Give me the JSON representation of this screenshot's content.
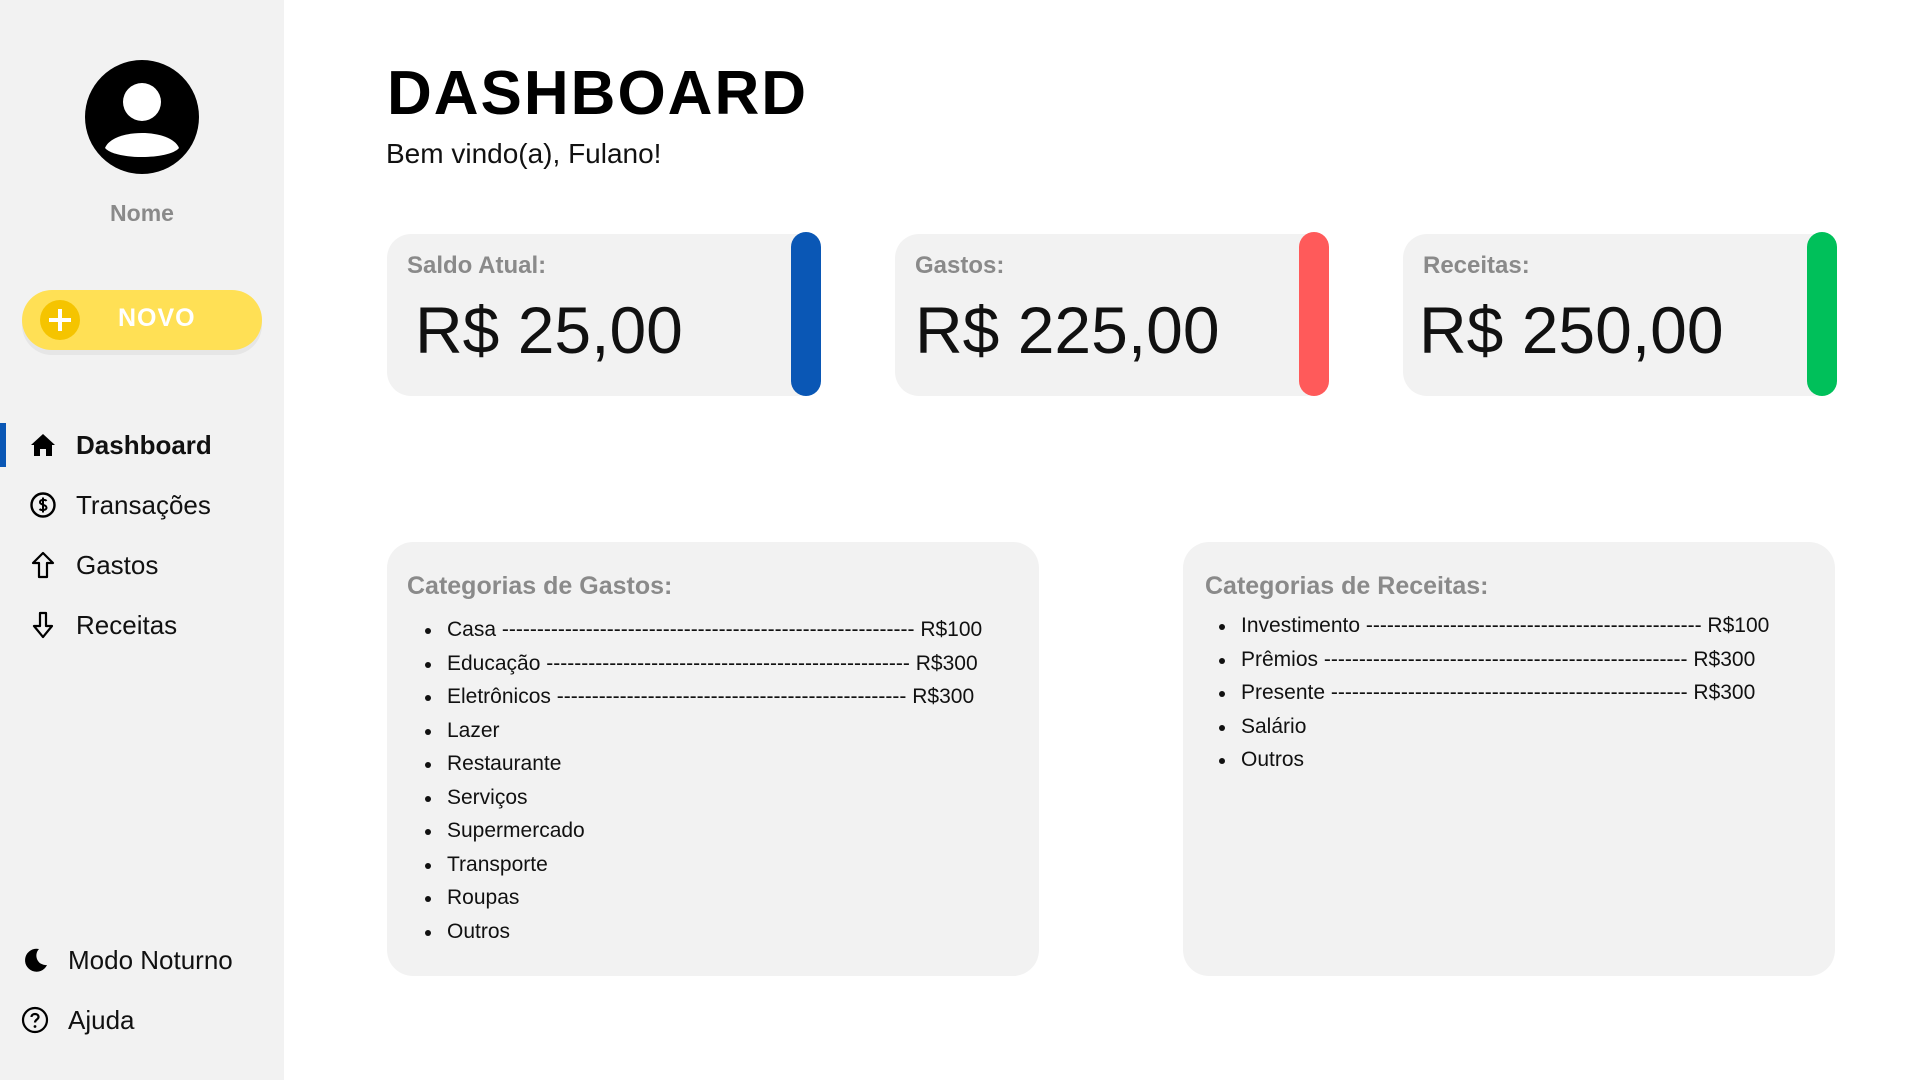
{
  "user": {
    "name": "Nome"
  },
  "new_button": {
    "label": "NOVO"
  },
  "nav": {
    "items": [
      {
        "label": "Dashboard",
        "icon": "home-icon",
        "active": true
      },
      {
        "label": "Transações",
        "icon": "dollar-circle-icon"
      },
      {
        "label": "Gastos",
        "icon": "arrow-up-icon"
      },
      {
        "label": "Receitas",
        "icon": "arrow-down-icon"
      }
    ],
    "bottom": [
      {
        "label": "Modo Noturno",
        "icon": "moon-icon"
      },
      {
        "label": "Ajuda",
        "icon": "help-circle-icon"
      }
    ]
  },
  "header": {
    "title": "DASHBOARD",
    "welcome": "Bem vindo(a), Fulano!"
  },
  "cards": [
    {
      "label": "Saldo Atual:",
      "value": "R$ 25,00",
      "color": "#0a57b5"
    },
    {
      "label": "Gastos:",
      "value": "R$ 225,00",
      "color": "#ff5a5a"
    },
    {
      "label": "Receitas:",
      "value": "R$ 250,00",
      "color": "#00c05a"
    }
  ],
  "expense_categories": {
    "title": "Categorias de Gastos:",
    "items": [
      {
        "label": "Casa",
        "dashes": "-----------------------------------------------------------",
        "amount": "R$100"
      },
      {
        "label": "Educação",
        "dashes": "----------------------------------------------------",
        "amount": "R$300"
      },
      {
        "label": "Eletrônicos",
        "dashes": "--------------------------------------------------",
        "amount": "R$300"
      },
      {
        "label": "Lazer"
      },
      {
        "label": "Restaurante"
      },
      {
        "label": "Serviços"
      },
      {
        "label": "Supermercado"
      },
      {
        "label": "Transporte"
      },
      {
        "label": "Roupas"
      },
      {
        "label": "Outros"
      }
    ]
  },
  "income_categories": {
    "title": "Categorias de Receitas:",
    "items": [
      {
        "label": "Investimento",
        "dashes": "------------------------------------------------",
        "amount": "R$100"
      },
      {
        "label": "Prêmios",
        "dashes": "----------------------------------------------------",
        "amount": "R$300"
      },
      {
        "label": "Presente",
        "dashes": "---------------------------------------------------",
        "amount": "R$300"
      },
      {
        "label": "Salário"
      },
      {
        "label": "Outros"
      }
    ]
  }
}
